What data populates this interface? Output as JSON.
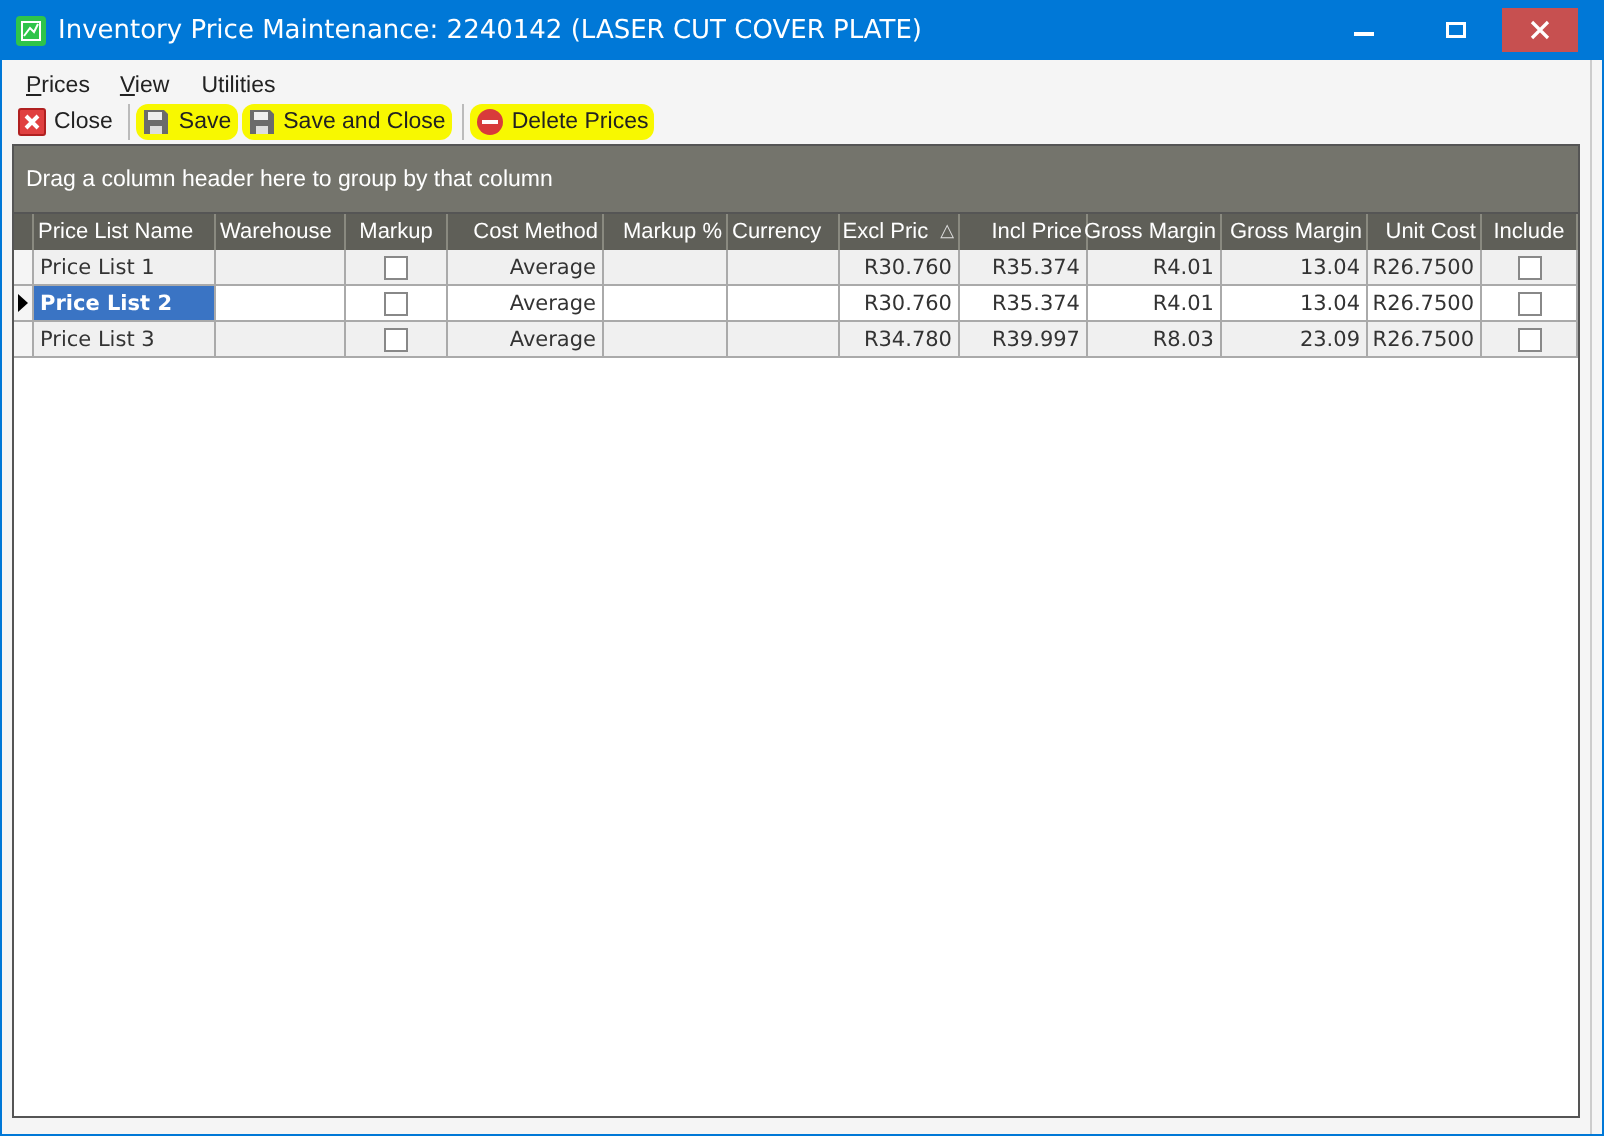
{
  "window": {
    "title": "Inventory Price Maintenance: 2240142 (LASER CUT COVER PLATE)"
  },
  "menu": [
    {
      "label": "Prices",
      "mnemonic": true
    },
    {
      "label": "View",
      "mnemonic": true
    },
    {
      "label": "Utilities",
      "mnemonic": false
    }
  ],
  "toolbar": [
    {
      "label": "Close",
      "kind": "close",
      "highlighted": false
    },
    {
      "label": "Save",
      "kind": "save",
      "highlighted": true
    },
    {
      "label": "Save and Close",
      "kind": "save",
      "highlighted": true
    },
    {
      "label": "Delete Prices",
      "kind": "delete",
      "highlighted": true
    }
  ],
  "group_panel": {
    "hint": "Drag a column header here to group by that column"
  },
  "table": {
    "columns": [
      {
        "label": "Price List Name",
        "kind": "text"
      },
      {
        "label": "Warehouse",
        "kind": "text"
      },
      {
        "label": "Markup",
        "kind": "check"
      },
      {
        "label": "Cost Method",
        "kind": "number"
      },
      {
        "label": "Markup %",
        "kind": "number"
      },
      {
        "label": "Currency",
        "kind": "text"
      },
      {
        "label": "Excl Pric",
        "kind": "number",
        "sort_indicator": "△"
      },
      {
        "label": "Incl Price",
        "kind": "number"
      },
      {
        "label": "Gross Margin",
        "kind": "number"
      },
      {
        "label": "Gross Margin",
        "kind": "number"
      },
      {
        "label": "Unit Cost",
        "kind": "number"
      },
      {
        "label": "Include",
        "kind": "check"
      }
    ],
    "rows": [
      {
        "selected": false,
        "cells": [
          "Price List 1",
          "",
          false,
          "Average",
          "",
          "",
          "R30.760",
          "R35.374",
          "R4.01",
          "13.04",
          "R26.7500",
          false
        ]
      },
      {
        "selected": true,
        "cells": [
          "Price List 2",
          "",
          false,
          "Average",
          "",
          "",
          "R30.760",
          "R35.374",
          "R4.01",
          "13.04",
          "R26.7500",
          false
        ]
      },
      {
        "selected": false,
        "cells": [
          "Price List 3",
          "",
          false,
          "Average",
          "",
          "",
          "R34.780",
          "R39.997",
          "R8.03",
          "23.09",
          "R26.7500",
          false
        ]
      }
    ]
  }
}
